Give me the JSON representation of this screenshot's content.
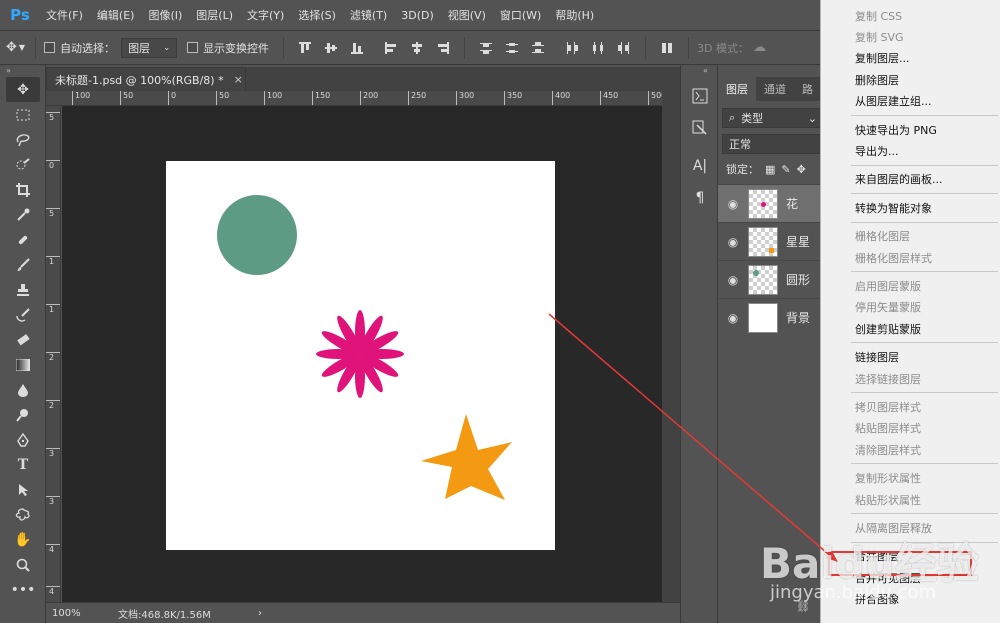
{
  "app": {
    "logo": "Ps"
  },
  "menubar": [
    "文件(F)",
    "编辑(E)",
    "图像(I)",
    "图层(L)",
    "文字(Y)",
    "选择(S)",
    "滤镜(T)",
    "3D(D)",
    "视图(V)",
    "窗口(W)",
    "帮助(H)"
  ],
  "options": {
    "auto_select_label": "自动选择：",
    "auto_select_value": "图层",
    "show_transform_label": "显示变换控件",
    "mode_3d_label": "3D 模式："
  },
  "document": {
    "tab_title": "未标题-1.psd @ 100%(RGB/8) *",
    "close_glyph": "×",
    "ruler_h": [
      "100",
      "50",
      "0",
      "50",
      "100",
      "150",
      "200",
      "250",
      "300",
      "350",
      "400",
      "450",
      "500"
    ],
    "ruler_v": [
      "5",
      "0",
      "5",
      "1",
      "1",
      "2",
      "2",
      "3",
      "3",
      "4",
      "4",
      "5"
    ],
    "zoom": "100%",
    "doc_info": "文档:468.8K/1.56M",
    "canvas_bg": "#ffffff",
    "pasteboard_bg": "#282828"
  },
  "shapes": {
    "circle_color": "#5e9b85",
    "flower_color": "#e0137a",
    "star_color": "#f39a12"
  },
  "layers_panel": {
    "tabs": [
      "图层",
      "通道",
      "路"
    ],
    "filter_label": "类型",
    "blend_mode": "正常",
    "lock_label": "锁定：",
    "layers": [
      {
        "name": "花",
        "selected": true
      },
      {
        "name": "星星",
        "selected": false
      },
      {
        "name": "圆形",
        "selected": false
      },
      {
        "name": "背景",
        "selected": false
      }
    ]
  },
  "context_menu": {
    "groups": [
      [
        {
          "label": "复制 CSS",
          "disabled": true
        },
        {
          "label": "复制 SVG",
          "disabled": true
        },
        {
          "label": "复制图层...",
          "disabled": false
        },
        {
          "label": "删除图层",
          "disabled": false
        },
        {
          "label": "从图层建立组...",
          "disabled": false
        }
      ],
      [
        {
          "label": "快速导出为 PNG",
          "disabled": false
        },
        {
          "label": "导出为...",
          "disabled": false
        }
      ],
      [
        {
          "label": "来自图层的画板...",
          "disabled": false
        }
      ],
      [
        {
          "label": "转换为智能对象",
          "disabled": false
        }
      ],
      [
        {
          "label": "栅格化图层",
          "disabled": true
        },
        {
          "label": "栅格化图层样式",
          "disabled": true
        }
      ],
      [
        {
          "label": "启用图层蒙版",
          "disabled": true
        },
        {
          "label": "停用矢量蒙版",
          "disabled": true
        },
        {
          "label": "创建剪贴蒙版",
          "disabled": false
        }
      ],
      [
        {
          "label": "链接图层",
          "disabled": false
        },
        {
          "label": "选择链接图层",
          "disabled": true
        }
      ],
      [
        {
          "label": "拷贝图层样式",
          "disabled": true
        },
        {
          "label": "粘贴图层样式",
          "disabled": true
        },
        {
          "label": "清除图层样式",
          "disabled": true
        }
      ],
      [
        {
          "label": "复制形状属性",
          "disabled": true
        },
        {
          "label": "粘贴形状属性",
          "disabled": true
        }
      ],
      [
        {
          "label": "从隔离图层释放",
          "disabled": true
        }
      ],
      [
        {
          "label": "合并图层",
          "disabled": false
        },
        {
          "label": "合并可见图层",
          "disabled": false
        },
        {
          "label": "拼合图像",
          "disabled": false
        }
      ]
    ],
    "highlight_color": "#e53935"
  },
  "watermark": {
    "text": "Baidu经验",
    "sub": "jingyan.baidu.com"
  }
}
